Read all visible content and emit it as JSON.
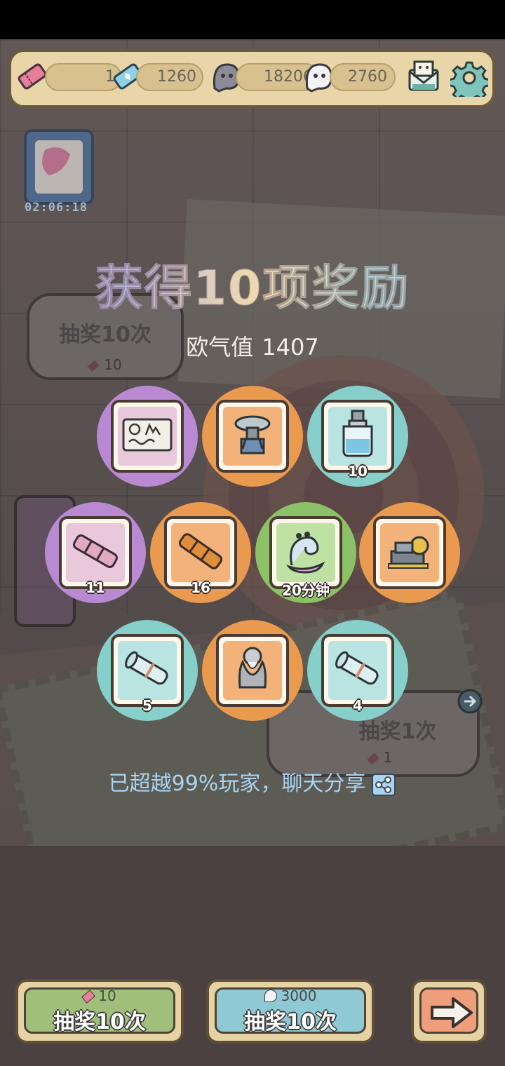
{
  "top_bar": {
    "ticket_count": "1",
    "crystal_count": "1260",
    "dark_ghost_count": "18206",
    "light_ghost_count": "2760"
  },
  "event_timer": "02:06:18",
  "background_buttons": {
    "draw_ten": {
      "label": "抽奖10次",
      "cost": "10"
    },
    "draw_one": {
      "label": "抽奖1次",
      "cost": "1"
    }
  },
  "result": {
    "title": "获得10项奖励",
    "luck_label": "欧气值",
    "luck_value": "1407",
    "rank_text": "已超越99%玩家，聊天分享"
  },
  "rewards": [
    {
      "name": "blueprint-document",
      "rarity": "purple",
      "count": ""
    },
    {
      "name": "claw-machine",
      "rarity": "orange",
      "count": ""
    },
    {
      "name": "potion-bottle",
      "rarity": "teal",
      "count": "10"
    },
    {
      "name": "pink-telescope",
      "rarity": "purple",
      "count": "11"
    },
    {
      "name": "orange-telescope",
      "rarity": "orange",
      "count": "16"
    },
    {
      "name": "ghost-snail",
      "rarity": "green",
      "count": "20分钟"
    },
    {
      "name": "gold-machine",
      "rarity": "orange",
      "count": ""
    },
    {
      "name": "scroll",
      "rarity": "teal",
      "count": "5"
    },
    {
      "name": "bearded-statue",
      "rarity": "orange",
      "count": ""
    },
    {
      "name": "scroll",
      "rarity": "teal",
      "count": "4"
    }
  ],
  "bottom_buttons": {
    "ticket_draw": {
      "cost": "10",
      "label": "抽奖10次"
    },
    "ghost_draw": {
      "cost": "3000",
      "label": "抽奖10次"
    }
  },
  "colors": {
    "purple": "#b98ad2",
    "orange": "#e99a4e",
    "teal": "#86cfca",
    "green": "#8cc168",
    "ticket_btn": "#9fbf7a",
    "ghost_btn": "#8fc9d3",
    "next_btn": "#ee9e7a"
  }
}
